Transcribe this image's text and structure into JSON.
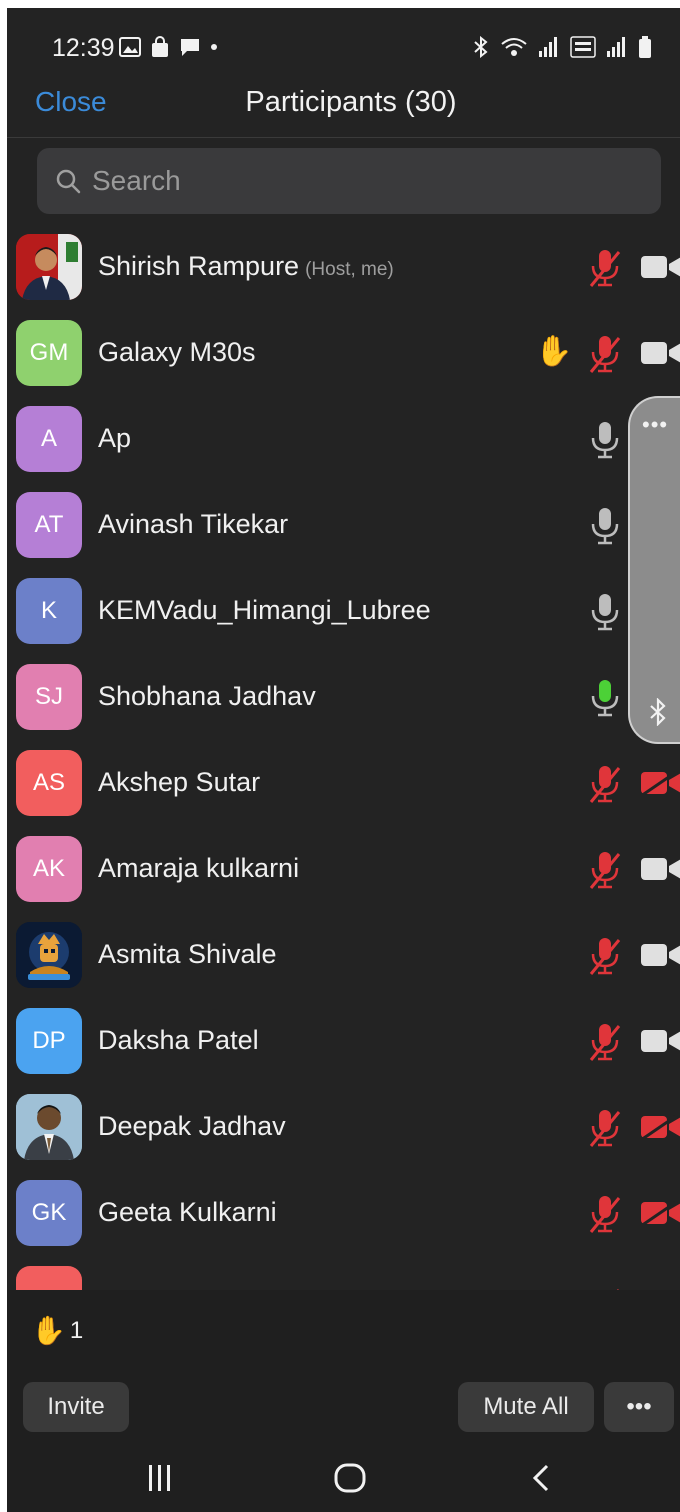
{
  "status_bar": {
    "time": "12:39"
  },
  "header": {
    "close_label": "Close",
    "title": "Participants (30)"
  },
  "search": {
    "placeholder": "Search"
  },
  "participants": [
    {
      "initials": "",
      "name": "Shirish Rampure",
      "role": "(Host, me)",
      "mic": "muted",
      "camera": "off",
      "hand_raised": false
    },
    {
      "initials": "GM",
      "name": "Galaxy M30s",
      "role": "",
      "mic": "muted",
      "camera": "off",
      "hand_raised": true
    },
    {
      "initials": "A",
      "name": "Ap",
      "role": "",
      "mic": "unmuted",
      "camera": "none",
      "hand_raised": false
    },
    {
      "initials": "AT",
      "name": "Avinash Tikekar",
      "role": "",
      "mic": "unmuted",
      "camera": "none",
      "hand_raised": false
    },
    {
      "initials": "K",
      "name": "KEMVadu_Himangi_Lubree",
      "role": "",
      "mic": "unmuted",
      "camera": "none",
      "hand_raised": false
    },
    {
      "initials": "SJ",
      "name": "Shobhana Jadhav",
      "role": "",
      "mic": "speaking",
      "camera": "none",
      "hand_raised": false
    },
    {
      "initials": "AS",
      "name": "Akshep Sutar",
      "role": "",
      "mic": "muted",
      "camera": "blocked",
      "hand_raised": false
    },
    {
      "initials": "AK",
      "name": "Amaraja kulkarni",
      "role": "",
      "mic": "muted",
      "camera": "off",
      "hand_raised": false
    },
    {
      "initials": "",
      "name": "Asmita Shivale",
      "role": "",
      "mic": "muted",
      "camera": "off",
      "hand_raised": false
    },
    {
      "initials": "DP",
      "name": "Daksha Patel",
      "role": "",
      "mic": "muted",
      "camera": "off",
      "hand_raised": false
    },
    {
      "initials": "",
      "name": "Deepak Jadhav",
      "role": "",
      "mic": "muted",
      "camera": "blocked",
      "hand_raised": false
    },
    {
      "initials": "GK",
      "name": "Geeta Kulkarni",
      "role": "",
      "mic": "muted",
      "camera": "blocked",
      "hand_raised": false
    }
  ],
  "footer": {
    "raised_hands_count": "1",
    "invite_label": "Invite",
    "mute_all_label": "Mute All",
    "more_label": "•••"
  },
  "floating": {
    "dots": "•••"
  },
  "colors": {
    "accent": "#3b8bd9",
    "muted_red": "#e0353a",
    "speaking_green": "#4cd137",
    "background": "#232323",
    "hand_yellow": "#f5c518"
  }
}
